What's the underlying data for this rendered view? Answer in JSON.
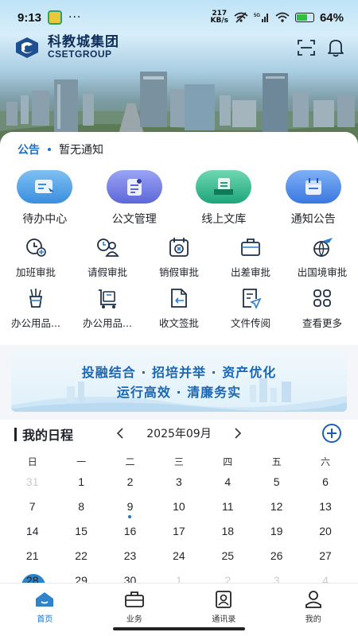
{
  "status_bar": {
    "time": "9:13",
    "dots": "···",
    "net_speed_top": "217",
    "net_speed_bottom": "KB/s",
    "network_label": "5G",
    "battery_percent": "64%",
    "battery_level": 0.64,
    "icons": [
      "app-notification-icon",
      "wifi-off-icon",
      "signal-icon",
      "wifi-icon",
      "battery-icon"
    ]
  },
  "header": {
    "brand_cn": "科教城集团",
    "brand_en": "CSETGROUP",
    "icons": [
      "scan-icon",
      "bell-icon"
    ]
  },
  "notice": {
    "tag": "公告",
    "text": "暂无通知"
  },
  "main_apps": [
    {
      "label": "待办中心",
      "icon": "todo-icon",
      "color": "#4a9ae0"
    },
    {
      "label": "公文管理",
      "icon": "document-icon",
      "color": "#6a76e4"
    },
    {
      "label": "线上文库",
      "icon": "library-icon",
      "color": "#29b58a"
    },
    {
      "label": "通知公告",
      "icon": "calendar-notice-icon",
      "color": "#3f83e6"
    }
  ],
  "sub_apps": [
    {
      "label": "加班审批",
      "icon": "overtime-icon"
    },
    {
      "label": "请假审批",
      "icon": "leave-icon"
    },
    {
      "label": "销假审批",
      "icon": "cancel-leave-icon"
    },
    {
      "label": "出差审批",
      "icon": "business-trip-icon"
    },
    {
      "label": "出国境审批",
      "icon": "overseas-icon"
    },
    {
      "label": "办公用品...",
      "icon": "office-supplies-icon"
    },
    {
      "label": "办公用品...",
      "icon": "office-supplies-receive-icon"
    },
    {
      "label": "收文签批",
      "icon": "receive-doc-icon"
    },
    {
      "label": "文件传阅",
      "icon": "file-circulate-icon"
    },
    {
      "label": "查看更多",
      "icon": "more-grid-icon"
    }
  ],
  "banner": {
    "line1": "投融结合 · 招培并举 · 资产优化",
    "line2": "运行高效 · 清廉务实"
  },
  "schedule": {
    "title": "我的日程",
    "month": "2025年09月",
    "weekdays": [
      "日",
      "一",
      "二",
      "三",
      "四",
      "五",
      "六"
    ],
    "weeks": [
      [
        {
          "d": "31",
          "muted": true
        },
        {
          "d": "1"
        },
        {
          "d": "2"
        },
        {
          "d": "3"
        },
        {
          "d": "4"
        },
        {
          "d": "5"
        },
        {
          "d": "6"
        }
      ],
      [
        {
          "d": "7"
        },
        {
          "d": "8"
        },
        {
          "d": "9",
          "event": true
        },
        {
          "d": "10"
        },
        {
          "d": "11"
        },
        {
          "d": "12"
        },
        {
          "d": "13"
        }
      ],
      [
        {
          "d": "14"
        },
        {
          "d": "15"
        },
        {
          "d": "16"
        },
        {
          "d": "17"
        },
        {
          "d": "18"
        },
        {
          "d": "19"
        },
        {
          "d": "20"
        }
      ],
      [
        {
          "d": "21"
        },
        {
          "d": "22"
        },
        {
          "d": "23"
        },
        {
          "d": "24"
        },
        {
          "d": "25"
        },
        {
          "d": "26"
        },
        {
          "d": "27"
        }
      ],
      [
        {
          "d": "28",
          "today": true
        },
        {
          "d": "29"
        },
        {
          "d": "30"
        },
        {
          "d": "1",
          "muted": true
        },
        {
          "d": "2",
          "muted": true
        },
        {
          "d": "3",
          "muted": true
        },
        {
          "d": "4",
          "muted": true
        }
      ]
    ]
  },
  "tabs": [
    {
      "label": "首页",
      "icon": "home-icon",
      "active": true
    },
    {
      "label": "业务",
      "icon": "briefcase-icon",
      "active": false
    },
    {
      "label": "通讯录",
      "icon": "contacts-icon",
      "active": false
    },
    {
      "label": "我的",
      "icon": "user-icon",
      "active": false
    }
  ],
  "colors": {
    "accent": "#1a74c8",
    "banner_text": "#1b66b3",
    "brand": "#0f2e5a"
  }
}
